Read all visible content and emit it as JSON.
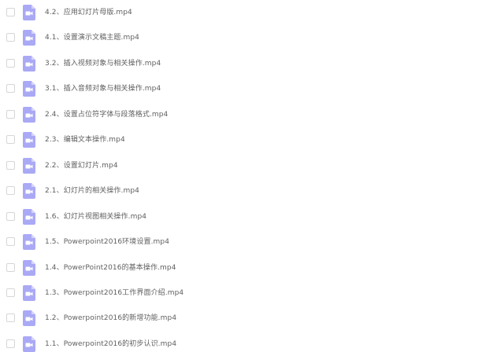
{
  "file_list": {
    "icon": "video-file-icon",
    "icon_color": "#aaa9f5",
    "items": [
      {
        "name": "4.2、应用幻灯片母版.mp4",
        "checked": false
      },
      {
        "name": "4.1、设置演示文稿主题.mp4",
        "checked": false
      },
      {
        "name": "3.2、插入视频对象与相关操作.mp4",
        "checked": false
      },
      {
        "name": "3.1、插入音频对象与相关操作.mp4",
        "checked": false
      },
      {
        "name": "2.4、设置占位符字体与段落格式.mp4",
        "checked": false
      },
      {
        "name": "2.3、编辑文本操作.mp4",
        "checked": false
      },
      {
        "name": "2.2、设置幻灯片.mp4",
        "checked": false
      },
      {
        "name": "2.1、幻灯片的相关操作.mp4",
        "checked": false
      },
      {
        "name": "1.6、幻灯片视图相关操作.mp4",
        "checked": false
      },
      {
        "name": "1.5、Powerpoint2016环境设置.mp4",
        "checked": false
      },
      {
        "name": "1.4、PowerPoint2016的基本操作.mp4",
        "checked": false
      },
      {
        "name": "1.3、Powerpoint2016工作界面介绍.mp4",
        "checked": false
      },
      {
        "name": "1.2、Powerpoint2016的新增功能.mp4",
        "checked": false
      },
      {
        "name": "1.1、Powerpoint2016的初步认识.mp4",
        "checked": false
      }
    ]
  }
}
